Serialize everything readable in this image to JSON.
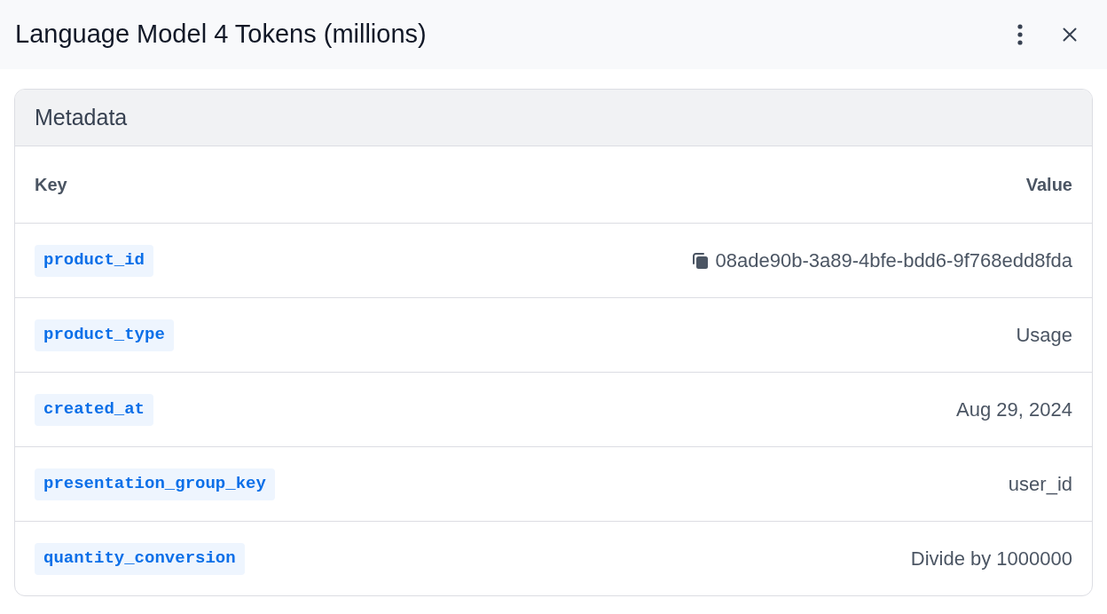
{
  "header": {
    "title": "Language Model 4 Tokens (millions)"
  },
  "metadata": {
    "title": "Metadata",
    "columns": [
      "Key",
      "Value"
    ],
    "rows": [
      {
        "key": "product_id",
        "value": "08ade90b-3a89-4bfe-bdd6-9f768edd8fda",
        "copyable": true
      },
      {
        "key": "product_type",
        "value": "Usage",
        "copyable": false
      },
      {
        "key": "created_at",
        "value": "Aug 29, 2024",
        "copyable": false
      },
      {
        "key": "presentation_group_key",
        "value": "user_id",
        "copyable": false
      },
      {
        "key": "quantity_conversion",
        "value": "Divide by 1000000",
        "copyable": false
      }
    ]
  }
}
